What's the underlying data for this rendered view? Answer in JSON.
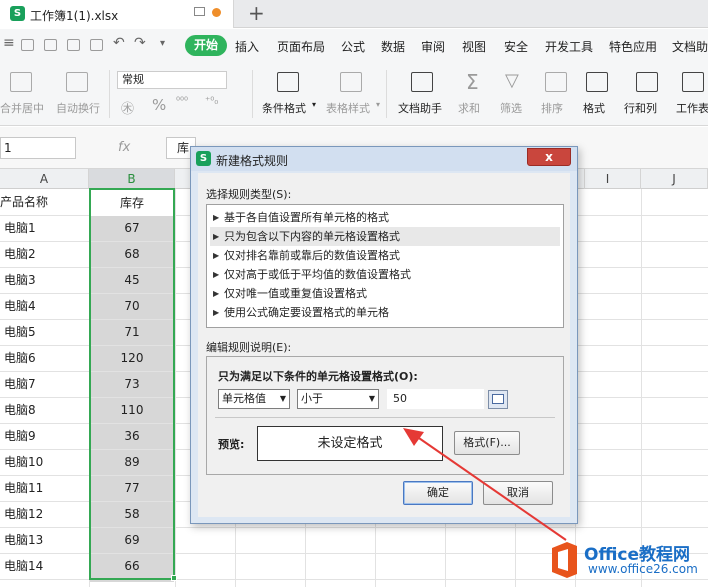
{
  "titlebar": {
    "doc_tab": "工作簿1(1).xlsx",
    "app_badge": "S",
    "new_tab": "+"
  },
  "menubar": {
    "start": "开始",
    "items": [
      "插入",
      "页面布局",
      "公式",
      "数据",
      "审阅",
      "视图",
      "安全",
      "开发工具",
      "特色应用",
      "文档助"
    ]
  },
  "ribbon": {
    "merge": "合并居中",
    "wrap": "自动换行",
    "number_format": "常规",
    "percent": "%",
    "cond_format": "条件格式",
    "table_style": "表格样式",
    "doc_helper": "文档助手",
    "sum": "求和",
    "filter": "筛选",
    "sort": "排序",
    "format": "格式",
    "rowcol": "行和列",
    "worksheet": "工作表"
  },
  "formulabar": {
    "namebox": "1",
    "fx": "fx",
    "content": "库"
  },
  "sheet": {
    "columns": [
      "A",
      "B",
      "C",
      "D",
      "E",
      "F",
      "G",
      "H",
      "I",
      "J"
    ],
    "header_a": "产品名称",
    "header_b": "库存",
    "rows": [
      {
        "name": "电脑1",
        "stock": "67"
      },
      {
        "name": "电脑2",
        "stock": "68"
      },
      {
        "name": "电脑3",
        "stock": "45"
      },
      {
        "name": "电脑4",
        "stock": "70"
      },
      {
        "name": "电脑5",
        "stock": "71"
      },
      {
        "name": "电脑6",
        "stock": "120"
      },
      {
        "name": "电脑7",
        "stock": "73"
      },
      {
        "name": "电脑8",
        "stock": "110"
      },
      {
        "name": "电脑9",
        "stock": "36"
      },
      {
        "name": "电脑10",
        "stock": "89"
      },
      {
        "name": "电脑11",
        "stock": "77"
      },
      {
        "name": "电脑12",
        "stock": "58"
      },
      {
        "name": "电脑13",
        "stock": "69"
      },
      {
        "name": "电脑14",
        "stock": "66"
      }
    ]
  },
  "dialog": {
    "title": "新建格式规则",
    "close": "x",
    "select_rule_label": "选择规则类型(S):",
    "rules": [
      "基于各自值设置所有单元格的格式",
      "只为包含以下内容的单元格设置格式",
      "仅对排名靠前或靠后的数值设置格式",
      "仅对高于或低于平均值的数值设置格式",
      "仅对唯一值或重复值设置格式",
      "使用公式确定要设置格式的单元格"
    ],
    "edit_label": "编辑规则说明(E):",
    "condition_label": "只为满足以下条件的单元格设置格式(O):",
    "dropdown1": "单元格值",
    "dropdown2": "小于",
    "value": "50",
    "preview_label": "预览:",
    "preview_text": "未设定格式",
    "format_button": "格式(F)...",
    "ok": "确定",
    "cancel": "取消"
  },
  "watermark": {
    "title": "Office教程网",
    "url": "www.office26.com"
  },
  "colors": {
    "accent_green": "#2fb45d",
    "selection": "#34a853",
    "arrow": "#e53935",
    "watermark": "#1a6ec6"
  }
}
